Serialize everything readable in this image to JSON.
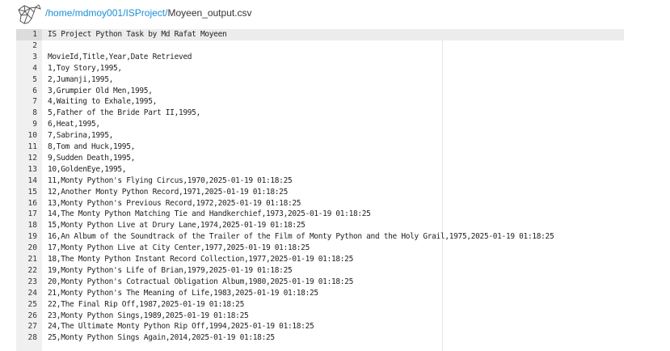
{
  "header": {
    "logo_icon": "geometric-animal-logo",
    "path_segments": [
      "home",
      "mdmoy001",
      "ISProject"
    ],
    "path_separator": "/",
    "filename": "Moyeen_output.csv",
    "link_color": "#1a8fd6"
  },
  "editor": {
    "active_line": 1,
    "lines": [
      "IS Project Python Task by Md Rafat Moyeen",
      "",
      "MovieId,Title,Year,Date Retrieved",
      "1,Toy Story,1995,",
      "2,Jumanji,1995,",
      "3,Grumpier Old Men,1995,",
      "4,Waiting to Exhale,1995,",
      "5,Father of the Bride Part II,1995,",
      "6,Heat,1995,",
      "7,Sabrina,1995,",
      "8,Tom and Huck,1995,",
      "9,Sudden Death,1995,",
      "10,GoldenEye,1995,",
      "11,Monty Python's Flying Circus,1970,2025-01-19 01:18:25",
      "12,Another Monty Python Record,1971,2025-01-19 01:18:25",
      "13,Monty Python's Previous Record,1972,2025-01-19 01:18:25",
      "14,The Monty Python Matching Tie and Handkerchief,1973,2025-01-19 01:18:25",
      "15,Monty Python Live at Drury Lane,1974,2025-01-19 01:18:25",
      "16,An Album of the Soundtrack of the Trailer of the Film of Monty Python and the Holy Grail,1975,2025-01-19 01:18:25",
      "17,Monty Python Live at City Center,1977,2025-01-19 01:18:25",
      "18,The Monty Python Instant Record Collection,1977,2025-01-19 01:18:25",
      "19,Monty Python's Life of Brian,1979,2025-01-19 01:18:25",
      "20,Monty Python's Cotractual Obligation Album,1980,2025-01-19 01:18:25",
      "21,Monty Python's The Meaning of Life,1983,2025-01-19 01:18:25",
      "22,The Final Rip Off,1987,2025-01-19 01:18:25",
      "23,Monty Python Sings,1989,2025-01-19 01:18:25",
      "24,The Ultimate Monty Python Rip Off,1994,2025-01-19 01:18:25",
      "25,Monty Python Sings Again,2014,2025-01-19 01:18:25"
    ]
  }
}
